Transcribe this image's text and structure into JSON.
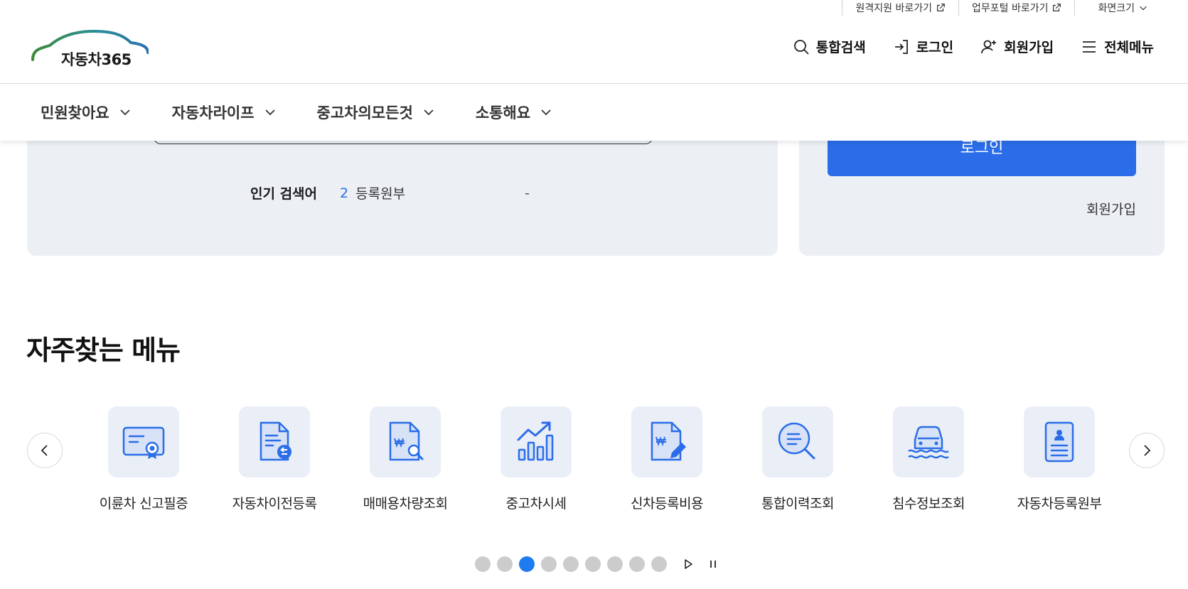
{
  "util_bar": {
    "remote_support": "원격지원 바로가기",
    "work_portal": "업무포털 바로가기",
    "screen_size": "화면크기"
  },
  "header": {
    "logo_text": "자동차365",
    "search": "통합검색",
    "login": "로그인",
    "signup": "회원가입",
    "all_menu": "전체메뉴"
  },
  "main_nav": [
    {
      "label": "민원찾아요"
    },
    {
      "label": "자동차라이프"
    },
    {
      "label": "중고차의모든것"
    },
    {
      "label": "소통해요"
    }
  ],
  "search_panel": {
    "popular_label": "인기 검색어",
    "rank": "2",
    "keyword": "등록원부",
    "dash": "-"
  },
  "login_panel": {
    "login_button": "로그인",
    "signup_link": "회원가입"
  },
  "frequent_menu": {
    "title": "자주찾는 메뉴",
    "items": [
      {
        "label": "이륜차 신고필증",
        "icon": "certificate-icon"
      },
      {
        "label": "자동차이전등록",
        "icon": "document-transfer-icon"
      },
      {
        "label": "매매용차량조회",
        "icon": "document-search-won-icon"
      },
      {
        "label": "중고차시세",
        "icon": "chart-trend-icon"
      },
      {
        "label": "신차등록비용",
        "icon": "document-won-pen-icon"
      },
      {
        "label": "통합이력조회",
        "icon": "magnifier-list-icon"
      },
      {
        "label": "침수정보조회",
        "icon": "car-flood-icon"
      },
      {
        "label": "자동차등록원부",
        "icon": "id-card-icon"
      }
    ]
  },
  "pagination": {
    "total_dots": 9,
    "active_index": 2
  },
  "colors": {
    "primary": "#2b6de8",
    "panel_bg": "#ecf0f5",
    "icon_bg": "#e9eef7",
    "dot_active": "#1f7cf0",
    "dot_inactive": "#cccccc"
  }
}
